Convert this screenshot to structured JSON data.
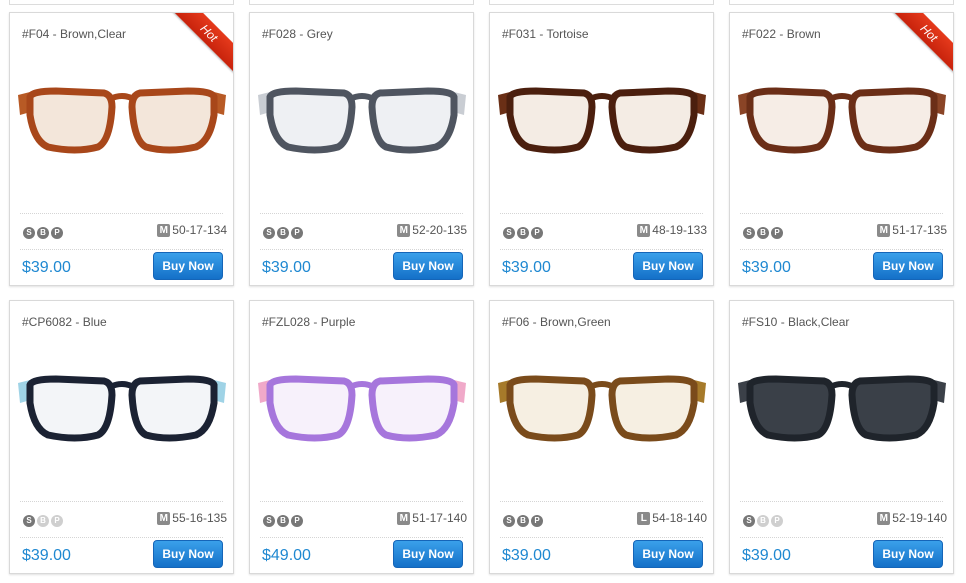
{
  "products": [
    {
      "title": "#F04 - Brown,Clear",
      "hot": "Hot",
      "badges": [
        "S",
        "B",
        "P"
      ],
      "badges_on": [
        true,
        true,
        true
      ],
      "size_letter": "M",
      "size": "50-17-134",
      "price": "$39.00",
      "buy": "Buy Now",
      "frame_color": "#a8471a",
      "lens_color": "#f3e6da",
      "temple_color": "#b85a25"
    },
    {
      "title": "#F028 - Grey",
      "hot": "",
      "badges": [
        "S",
        "B",
        "P"
      ],
      "badges_on": [
        true,
        true,
        true
      ],
      "size_letter": "M",
      "size": "52-20-135",
      "price": "$39.00",
      "buy": "Buy Now",
      "frame_color": "#4f5560",
      "lens_color": "#eef0f3",
      "temple_color": "#c9cdd3"
    },
    {
      "title": "#F031 - Tortoise",
      "hot": "",
      "badges": [
        "S",
        "B",
        "P"
      ],
      "badges_on": [
        true,
        true,
        true
      ],
      "size_letter": "M",
      "size": "48-19-133",
      "price": "$39.00",
      "buy": "Buy Now",
      "frame_color": "#4b1f0e",
      "lens_color": "#f4ece4",
      "temple_color": "#6a2f16"
    },
    {
      "title": "#F022 - Brown",
      "hot": "Hot",
      "badges": [
        "S",
        "B",
        "P"
      ],
      "badges_on": [
        true,
        true,
        true
      ],
      "size_letter": "M",
      "size": "51-17-135",
      "price": "$39.00",
      "buy": "Buy Now",
      "frame_color": "#6b2e17",
      "lens_color": "#f6ede6",
      "temple_color": "#8a4426"
    },
    {
      "title": "#CP6082 - Blue",
      "hot": "",
      "badges": [
        "S",
        "B",
        "P"
      ],
      "badges_on": [
        true,
        false,
        false
      ],
      "size_letter": "M",
      "size": "55-16-135",
      "price": "$39.00",
      "buy": "Buy Now",
      "frame_color": "#1b2233",
      "lens_color": "#f3f5f8",
      "temple_color": "#9fd3e6"
    },
    {
      "title": "#FZL028 - Purple",
      "hot": "",
      "badges": [
        "S",
        "B",
        "P"
      ],
      "badges_on": [
        true,
        true,
        true
      ],
      "size_letter": "M",
      "size": "51-17-140",
      "price": "$49.00",
      "buy": "Buy Now",
      "frame_color": "#a676dc",
      "lens_color": "#f7f1fb",
      "temple_color": "#f0a9c9"
    },
    {
      "title": "#F06 - Brown,Green",
      "hot": "",
      "badges": [
        "S",
        "B",
        "P"
      ],
      "badges_on": [
        true,
        true,
        true
      ],
      "size_letter": "L",
      "size": "54-18-140",
      "price": "$39.00",
      "buy": "Buy Now",
      "frame_color": "#7a4b1b",
      "lens_color": "#f6efe2",
      "temple_color": "#a67a2a"
    },
    {
      "title": "#FS10 - Black,Clear",
      "hot": "",
      "badges": [
        "S",
        "B",
        "P"
      ],
      "badges_on": [
        true,
        false,
        false
      ],
      "size_letter": "M",
      "size": "52-19-140",
      "price": "$39.00",
      "buy": "Buy Now",
      "frame_color": "#1f242b",
      "lens_color": "#3a4048",
      "temple_color": "#3b4048"
    }
  ]
}
